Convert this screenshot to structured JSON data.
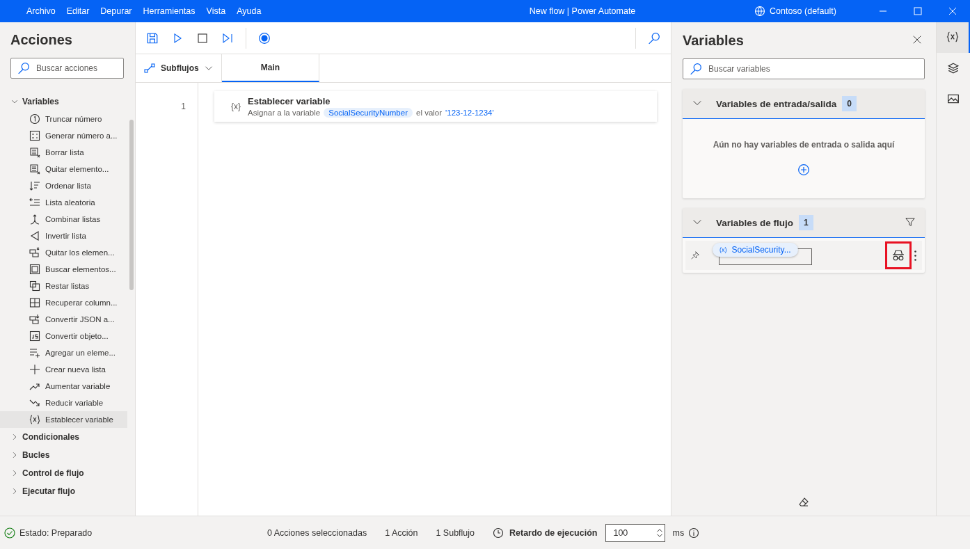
{
  "window": {
    "title": "New flow | Power Automate",
    "account": "Contoso (default)"
  },
  "menu": [
    "Archivo",
    "Editar",
    "Depurar",
    "Herramientas",
    "Vista",
    "Ayuda"
  ],
  "actions_panel": {
    "title": "Acciones",
    "search": {
      "placeholder": "Buscar acciones"
    },
    "tree": [
      {
        "label": "Variables",
        "expanded": true,
        "children": [
          {
            "label": "Truncar número",
            "selected": false
          },
          {
            "label": "Generar número a...",
            "selected": false
          },
          {
            "label": "Borrar lista",
            "selected": false
          },
          {
            "label": "Quitar elemento...",
            "selected": false
          },
          {
            "label": "Ordenar lista",
            "selected": false
          },
          {
            "label": "Lista aleatoria",
            "selected": false
          },
          {
            "label": "Combinar listas",
            "selected": false
          },
          {
            "label": "Invertir lista",
            "selected": false
          },
          {
            "label": "Quitar los elemen...",
            "selected": false
          },
          {
            "label": "Buscar elementos...",
            "selected": false
          },
          {
            "label": "Restar listas",
            "selected": false
          },
          {
            "label": "Recuperar column...",
            "selected": false
          },
          {
            "label": "Convertir JSON a...",
            "selected": false
          },
          {
            "label": "Convertir objeto...",
            "selected": false
          },
          {
            "label": "Agregar un eleme...",
            "selected": false
          },
          {
            "label": "Crear nueva lista",
            "selected": false
          },
          {
            "label": "Aumentar variable",
            "selected": false
          },
          {
            "label": "Reducir variable",
            "selected": false
          },
          {
            "label": "Establecer variable",
            "selected": true
          }
        ]
      },
      {
        "label": "Condicionales",
        "expanded": false
      },
      {
        "label": "Bucles",
        "expanded": false
      },
      {
        "label": "Control de flujo",
        "expanded": false
      },
      {
        "label": "Ejecutar flujo",
        "expanded": false
      }
    ]
  },
  "editor": {
    "subflows_label": "Subflujos",
    "tabs": [
      {
        "label": "Main",
        "selected": true
      }
    ],
    "steps": [
      {
        "number": "1",
        "icon": "{x}",
        "title": "Establecer variable",
        "text_before": "Asignar a la variable",
        "variable": "SocialSecurityNumber",
        "text_middle": "el valor",
        "value": "'123-12-1234'"
      }
    ]
  },
  "variables_panel": {
    "title": "Variables",
    "search": {
      "placeholder": "Buscar variables"
    },
    "sections": [
      {
        "title": "Variables de entrada/salida",
        "count": "0",
        "expanded": true,
        "empty_text": "Aún no hay variables de entrada o salida aquí",
        "has_filter": false
      },
      {
        "title": "Variables de flujo",
        "count": "1",
        "expanded": true,
        "has_filter": true,
        "items": [
          {
            "icon": "(x)",
            "name": "SocialSecurity...",
            "sensitive_highlighted": true
          }
        ]
      }
    ]
  },
  "status_bar": {
    "status": "Estado: Preparado",
    "selected_actions": "0 Acciones seleccionadas",
    "actions": "1 Acción",
    "subflows": "1 Subflujo",
    "delay_label": "Retardo de ejecución",
    "delay_value": "100",
    "delay_unit": "ms"
  }
}
